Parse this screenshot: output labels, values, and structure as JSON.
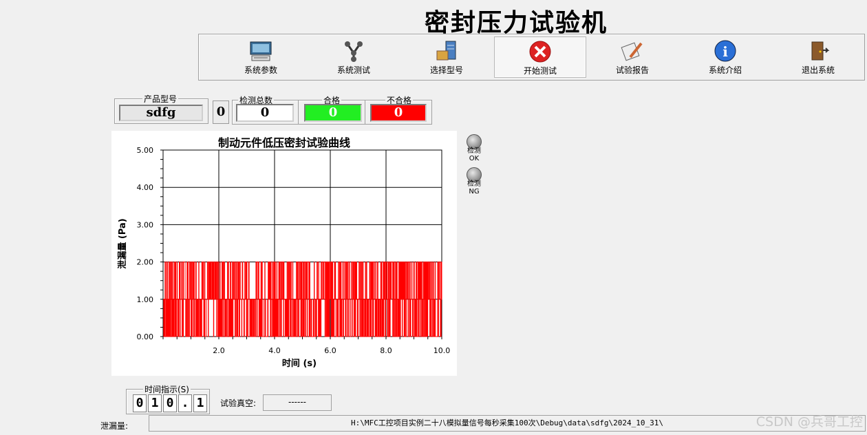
{
  "window": {
    "title": "密封压力试验机"
  },
  "toolbar": {
    "buttons": [
      {
        "label": "系统参数",
        "icon": "keyboard-icon"
      },
      {
        "label": "系统测试",
        "icon": "network-icon"
      },
      {
        "label": "选择型号",
        "icon": "server-box-icon"
      },
      {
        "label": "开始测试",
        "icon": "red-x-icon"
      },
      {
        "label": "试验报告",
        "icon": "scroll-pen-icon"
      },
      {
        "label": "系统介绍",
        "icon": "info-icon"
      },
      {
        "label": "退出系统",
        "icon": "exit-door-icon"
      }
    ],
    "active_index": 3
  },
  "product": {
    "label": "产品型号",
    "value": "sdfg"
  },
  "counter": {
    "small_value": "0"
  },
  "stats": {
    "total": {
      "label": "检测总数",
      "value": "0"
    },
    "pass": {
      "label": "合格",
      "value": "0",
      "color": "#22ee22"
    },
    "fail": {
      "label": "不合格",
      "value": "0",
      "color": "#ff0000"
    }
  },
  "indicators": {
    "ok": {
      "label1": "检测",
      "label2": "OK"
    },
    "ng": {
      "label1": "检测",
      "label2": "NG"
    }
  },
  "time": {
    "label": "时间指示(S)",
    "digits": [
      "0",
      "1",
      "0",
      ".",
      "1"
    ]
  },
  "vacuum": {
    "label": "试验真空:",
    "value": "------"
  },
  "leak": {
    "label": "泄漏量:",
    "path": "H:\\MFC工控项目实例二十八模拟量信号每秒采集100次\\Debug\\data\\sdfg\\2024_10_31\\"
  },
  "watermark": "CSDN @兵哥工控",
  "chart_data": {
    "type": "line",
    "title": "制动元件低压密封试验曲线",
    "xlabel": "时间 (s)",
    "ylabel": "泄漏量 (Pa)",
    "xlim": [
      0,
      10
    ],
    "ylim": [
      0,
      5
    ],
    "x_ticks": [
      "2.0",
      "4.0",
      "6.0",
      "8.0",
      "10.0"
    ],
    "y_ticks": [
      "0.00",
      "1.00",
      "2.00",
      "3.00",
      "4.00",
      "5.00"
    ],
    "grid": true,
    "series": [
      {
        "color": "#ff0000",
        "sample_interval_s": 0.01,
        "min": 0,
        "max": 2,
        "levels": [
          0,
          1,
          2
        ]
      }
    ]
  }
}
